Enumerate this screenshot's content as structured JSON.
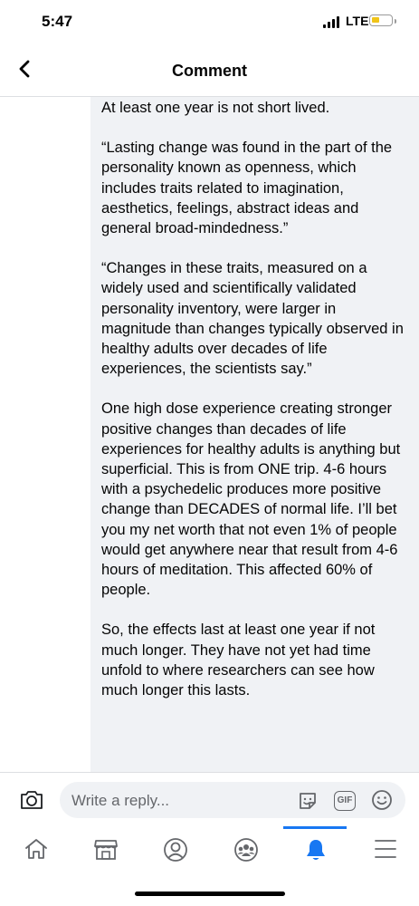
{
  "status_bar": {
    "time": "5:47",
    "network": "LTE",
    "battery_level": 0.25,
    "battery_color": "#f0c419"
  },
  "header": {
    "title": "Comment",
    "back_icon": "chevron-left-icon"
  },
  "comment": {
    "paragraphs": [
      "At least one year is not short lived.",
      "“Lasting change was found in the part of the personality known as openness, which includes traits related to imagination, aesthetics, feelings, abstract ideas and general broad-mindedness.”",
      "“Changes in these traits, measured on a widely used and scientifically validated personality inventory, were larger in magnitude than changes typically observed in healthy adults over decades of life experiences, the scientists say.”",
      "One high dose experience creating stronger positive changes than decades of life experiences for healthy adults is anything but superficial. This is from ONE trip. 4-6 hours with a psychedelic produces more positive change than DECADES of normal life. I’ll bet you my net worth that not even 1% of people would get anywhere near that result from 4-6 hours of meditation. This affected 60% of people.",
      "So, the effects last at least one year if not much longer. They have not yet had time unfold to where researchers can see how much longer this lasts."
    ],
    "bubble_color": "#f0f2f5"
  },
  "reply": {
    "placeholder": "Write a reply...",
    "gif_label": "GIF",
    "icons": [
      "camera-icon",
      "sticker-icon",
      "gif-icon",
      "emoji-icon"
    ]
  },
  "tabs": [
    {
      "name": "home",
      "icon": "home-icon",
      "active": false
    },
    {
      "name": "marketplace",
      "icon": "marketplace-icon",
      "active": false
    },
    {
      "name": "profile",
      "icon": "profile-icon",
      "active": false
    },
    {
      "name": "groups",
      "icon": "groups-icon",
      "active": false
    },
    {
      "name": "notifications",
      "icon": "bell-icon",
      "active": true
    },
    {
      "name": "menu",
      "icon": "menu-icon",
      "active": false
    }
  ],
  "colors": {
    "accent": "#1877f2",
    "icon_gray": "#65676b"
  }
}
